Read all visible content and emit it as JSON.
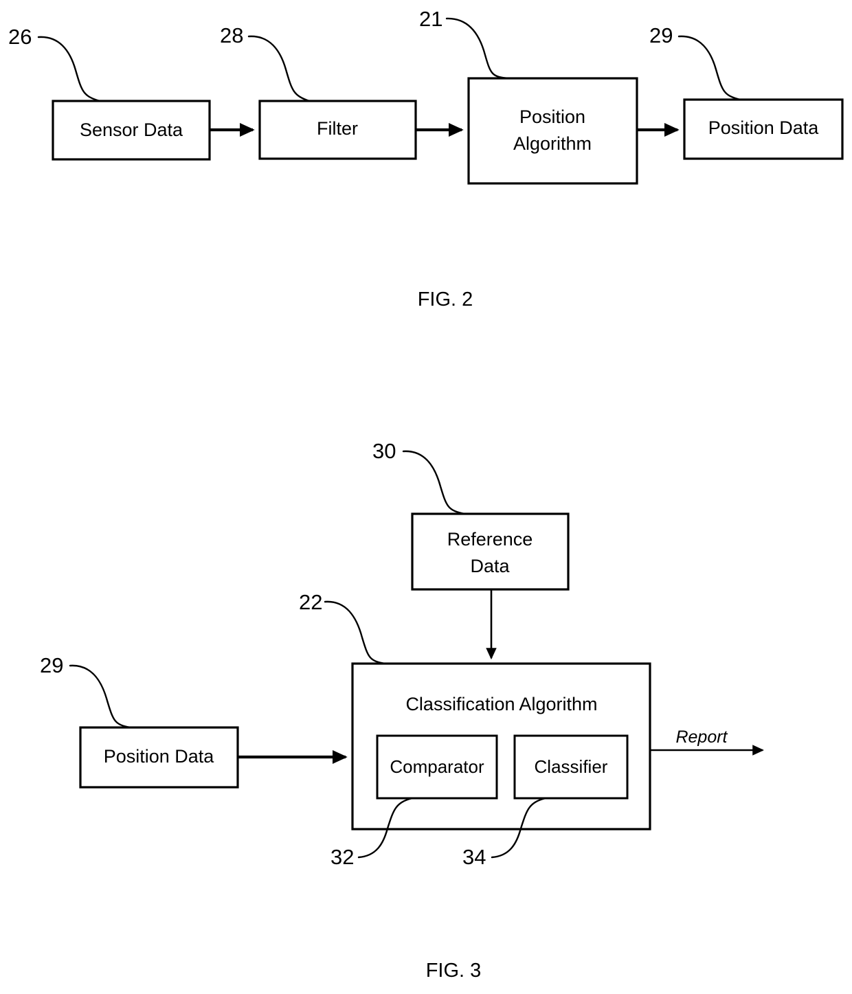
{
  "document": {
    "type": "patent-drawing-sheet",
    "figures": [
      "FIG. 2",
      "FIG. 3"
    ]
  },
  "figure2": {
    "caption": "FIG. 2",
    "blocks": [
      {
        "id": "sensor-data",
        "label": "Sensor Data",
        "ref": "26"
      },
      {
        "id": "filter",
        "label": "Filter",
        "ref": "28"
      },
      {
        "id": "position-algorithm",
        "label": "Position\nAlgorithm",
        "label_line1": "Position",
        "label_line2": "Algorithm",
        "ref": "21"
      },
      {
        "id": "position-data",
        "label": "Position Data",
        "ref": "29"
      }
    ],
    "flow": [
      {
        "from": "sensor-data",
        "to": "filter"
      },
      {
        "from": "filter",
        "to": "position-algorithm"
      },
      {
        "from": "position-algorithm",
        "to": "position-data"
      }
    ],
    "ref_numbers": [
      "26",
      "28",
      "21",
      "29"
    ]
  },
  "figure3": {
    "caption": "FIG. 3",
    "blocks": [
      {
        "id": "reference-data",
        "label_line1": "Reference",
        "label_line2": "Data",
        "ref": "30"
      },
      {
        "id": "position-data",
        "label": "Position Data",
        "ref": "29"
      },
      {
        "id": "classification-algorithm",
        "label": "Classification Algorithm",
        "ref": "22"
      },
      {
        "id": "comparator",
        "label": "Comparator",
        "ref": "32"
      },
      {
        "id": "classifier",
        "label": "Classifier",
        "ref": "34"
      }
    ],
    "flow": [
      {
        "from": "reference-data",
        "to": "classification-algorithm",
        "direction": "down"
      },
      {
        "from": "position-data",
        "to": "classification-algorithm",
        "direction": "right"
      },
      {
        "from": "classification-algorithm",
        "to": "output",
        "direction": "right",
        "label": "Report"
      }
    ],
    "output_label": "Report",
    "ref_numbers": [
      "30",
      "22",
      "29",
      "32",
      "34"
    ]
  },
  "colors": {
    "background": "#ffffff",
    "stroke": "#000000",
    "text": "#000000"
  }
}
